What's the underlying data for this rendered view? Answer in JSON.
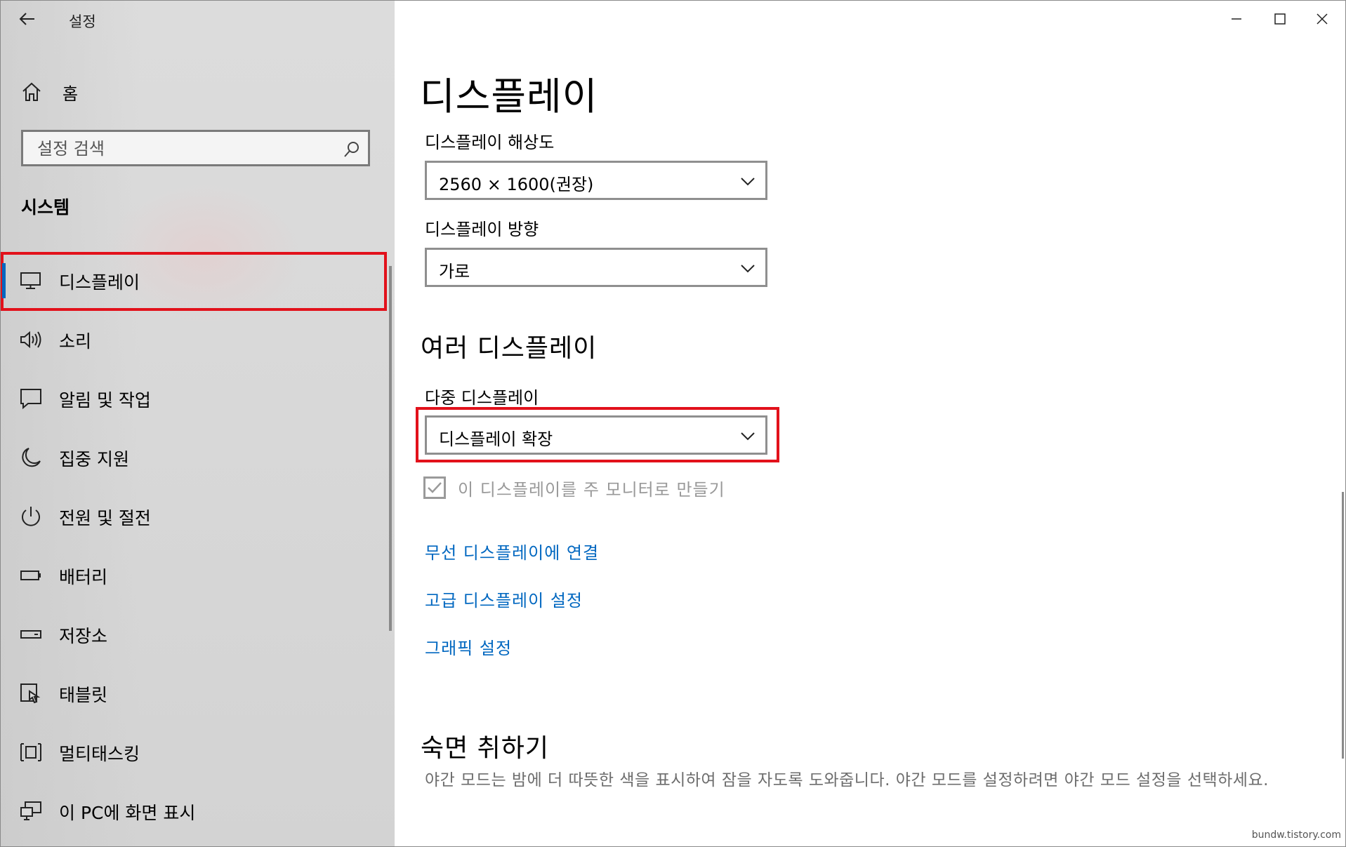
{
  "app": {
    "title": "설정"
  },
  "sidebar": {
    "home_label": "홈",
    "search_placeholder": "설정 검색",
    "section_title": "시스템",
    "items": [
      {
        "label": "디스플레이",
        "icon": "monitor-icon",
        "active": true
      },
      {
        "label": "소리",
        "icon": "speaker-icon"
      },
      {
        "label": "알림 및 작업",
        "icon": "notification-icon"
      },
      {
        "label": "집중 지원",
        "icon": "moon-icon"
      },
      {
        "label": "전원 및 절전",
        "icon": "power-icon"
      },
      {
        "label": "배터리",
        "icon": "battery-icon"
      },
      {
        "label": "저장소",
        "icon": "storage-icon"
      },
      {
        "label": "태블릿",
        "icon": "tablet-icon"
      },
      {
        "label": "멀티태스킹",
        "icon": "multitasking-icon"
      },
      {
        "label": "이 PC에 화면 표시",
        "icon": "project-icon"
      }
    ]
  },
  "content": {
    "page_title": "디스플레이",
    "resolution": {
      "label": "디스플레이 해상도",
      "value": "2560 × 1600(권장)"
    },
    "orientation": {
      "label": "디스플레이 방향",
      "value": "가로"
    },
    "multiple_displays": {
      "title": "여러 디스플레이",
      "label": "다중 디스플레이",
      "value": "디스플레이 확장",
      "checkbox_label": "이 디스플레이를 주 모니터로 만들기",
      "checkbox_checked": true
    },
    "links": [
      "무선 디스플레이에 연결",
      "고급 디스플레이 설정",
      "그래픽 설정"
    ],
    "sleep": {
      "title": "숙면 취하기",
      "description": "야간 모드는 밤에 더 따뜻한 색을 표시하여 잠을 자도록 도와줍니다. 야간 모드를 설정하려면 야간 모드 설정을 선택하세요."
    }
  },
  "watermark": "bundw.tistory.com",
  "colors": {
    "accent": "#0067c0",
    "highlight": "#e2111b"
  }
}
